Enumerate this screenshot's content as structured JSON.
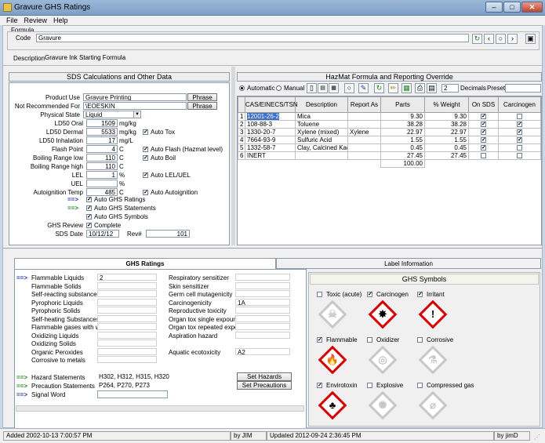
{
  "window": {
    "title": "Gravure GHS Ratings"
  },
  "menu": [
    "File",
    "Review",
    "Help"
  ],
  "formula": {
    "group_label": "Formula",
    "code_label": "Code",
    "code_value": "Gravure",
    "description_label": "Description",
    "description_value": "Gravure Ink Starting Formula"
  },
  "toolbar_icons": [
    "refresh-icon",
    "back-icon",
    "forward-icon",
    "search-icon",
    "zoom-icon",
    "save-icon"
  ],
  "sds": {
    "title": "SDS Calculations and Other Data",
    "product_use_label": "Product Use",
    "product_use_value": "Gravure Printing",
    "not_recommended_label": "Not Recommended For",
    "not_recommended_value": "\\EOESKIN",
    "phrase_label": "Phrase",
    "physical_state_label": "Physical State",
    "physical_state_value": "Liquid",
    "rows": [
      {
        "label": "LD50 Oral",
        "value": "1509",
        "unit": "mg/kg",
        "auto": ""
      },
      {
        "label": "LD50 Dermal",
        "value": "5533",
        "unit": "mg/kg",
        "auto": "Auto Tox"
      },
      {
        "label": "LD50 Inhalation",
        "value": "17",
        "unit": "mg/L",
        "auto": ""
      },
      {
        "label": "Flash Point",
        "value": "4",
        "unit": "C",
        "auto": "Auto Flash (Hazmat level)"
      },
      {
        "label": "Boiling Range low",
        "value": "110",
        "unit": "C",
        "auto": "Auto Boil"
      },
      {
        "label": "Boiling Range high",
        "value": "110",
        "unit": "C",
        "auto": ""
      },
      {
        "label": "LEL",
        "value": "1",
        "unit": "%",
        "auto": "Auto LEL/UEL"
      },
      {
        "label": "UEL",
        "value": "",
        "unit": "%",
        "auto": ""
      },
      {
        "label": "Autoignition Temp",
        "value": "485",
        "unit": "C",
        "auto": "Auto Autoignition"
      }
    ],
    "auto_ghs_ratings": "Auto GHS Ratings",
    "auto_ghs_statements": "Auto GHS Statements",
    "auto_ghs_symbols": "Auto GHS Symbols",
    "ghs_review_label": "GHS Review",
    "complete_label": "Complete",
    "sds_date_label": "SDS Date",
    "sds_date_value": "10/12/12",
    "rev_label": "Rev#",
    "rev_value": "101"
  },
  "hazmat": {
    "title": "HazMat Formula and Reporting Override",
    "automatic_label": "Automatic",
    "manual_label": "Manual",
    "decimals_value": "2",
    "decimals_label": "Decimals",
    "preset_label": "Preset",
    "headers": [
      "CAS/EINECS/TSN",
      "Description",
      "Report As",
      "Parts",
      "% Weight",
      "On SDS",
      "Carcinogen"
    ],
    "rows": [
      {
        "n": "1",
        "cas": "12001-26-2",
        "desc": "Mica",
        "report": "",
        "parts": "9.30",
        "weight": "9.30",
        "sds": true,
        "carc": false
      },
      {
        "n": "2",
        "cas": "108-88-3",
        "desc": "Toluene",
        "report": "",
        "parts": "38.28",
        "weight": "38.28",
        "sds": true,
        "carc": true
      },
      {
        "n": "3",
        "cas": "1330-20-7",
        "desc": "Xylene (mixed)",
        "report": "Xylene",
        "parts": "22.97",
        "weight": "22.97",
        "sds": true,
        "carc": true
      },
      {
        "n": "4",
        "cas": "7664-93-9",
        "desc": "Sulfuric Acid",
        "report": "",
        "parts": "1.55",
        "weight": "1.55",
        "sds": true,
        "carc": true
      },
      {
        "n": "5",
        "cas": "1332-58-7",
        "desc": "Clay, Calcined Kaolin",
        "report": "",
        "parts": "0.45",
        "weight": "0.45",
        "sds": true,
        "carc": false
      },
      {
        "n": "6",
        "cas": "INERT",
        "desc": "",
        "report": "",
        "parts": "27.45",
        "weight": "27.45",
        "sds": false,
        "carc": false
      }
    ],
    "total": "100.00"
  },
  "tabs": {
    "ghs_ratings": "GHS Ratings",
    "label_info": "Label Information"
  },
  "ratings_left": [
    {
      "label": "Flammable Liquids",
      "value": "2",
      "arrow": true
    },
    {
      "label": "Flammable Solids",
      "value": ""
    },
    {
      "label": "Self-reacting substances",
      "value": ""
    },
    {
      "label": "Pyrophoric Liquids",
      "value": ""
    },
    {
      "label": "Pyrophoric Solids",
      "value": ""
    },
    {
      "label": "Self-heating Substances",
      "value": ""
    },
    {
      "label": "Flammable gases with water",
      "value": ""
    },
    {
      "label": "Oxidizing Liquids",
      "value": ""
    },
    {
      "label": "Oxidizing Solids",
      "value": ""
    },
    {
      "label": "Organic Peroxides",
      "value": ""
    },
    {
      "label": "Corrosive to metals",
      "value": ""
    }
  ],
  "ratings_right": [
    {
      "label": "Respiratory sensitizer",
      "value": ""
    },
    {
      "label": "Skin sensitizer",
      "value": ""
    },
    {
      "label": "Germ cell mutagenicity",
      "value": ""
    },
    {
      "label": "Carcinogenicity",
      "value": "1A"
    },
    {
      "label": "Reproductive toxicity",
      "value": ""
    },
    {
      "label": "Organ tox single expoure",
      "value": ""
    },
    {
      "label": "Organ tox repeated exposure",
      "value": ""
    },
    {
      "label": "Aspiration hazard",
      "value": ""
    },
    {
      "label": "",
      "value": ""
    },
    {
      "label": "Aquatic ecotoxicity",
      "value": "A2"
    }
  ],
  "statements": {
    "hazard_label": "Hazard Statements",
    "hazard_value": "H302, H312, H315, H320",
    "set_hazards": "Set Hazards",
    "precaution_label": "Precaution Statements",
    "precaution_value": "P264, P270, P273",
    "set_precautions": "Set Precautions",
    "signal_label": "Signal Word",
    "signal_value": ""
  },
  "ghs_symbols": {
    "title": "GHS Symbols",
    "items": [
      {
        "label": "Toxic (acute)",
        "checked": false,
        "icon": "skull-icon"
      },
      {
        "label": "Carcinogen",
        "checked": true,
        "icon": "health-hazard-icon"
      },
      {
        "label": "Irritant",
        "checked": true,
        "icon": "exclamation-icon"
      },
      {
        "label": "Flammable",
        "checked": true,
        "icon": "flame-icon"
      },
      {
        "label": "Oxidizer",
        "checked": false,
        "icon": "flame-over-circle-icon"
      },
      {
        "label": "Corrosive",
        "checked": false,
        "icon": "corrosion-icon"
      },
      {
        "label": "Envirotoxin",
        "checked": true,
        "icon": "environment-icon"
      },
      {
        "label": "Explosive",
        "checked": false,
        "icon": "exploding-bomb-icon"
      },
      {
        "label": "Compressed gas",
        "checked": false,
        "icon": "gas-cylinder-icon"
      }
    ]
  },
  "status": {
    "added": "Added 2002-10-13 7:00:57 PM",
    "by1": "by JIM",
    "updated": "Updated 2012-09-24 2:36:45 PM",
    "by2": "by jimD"
  }
}
